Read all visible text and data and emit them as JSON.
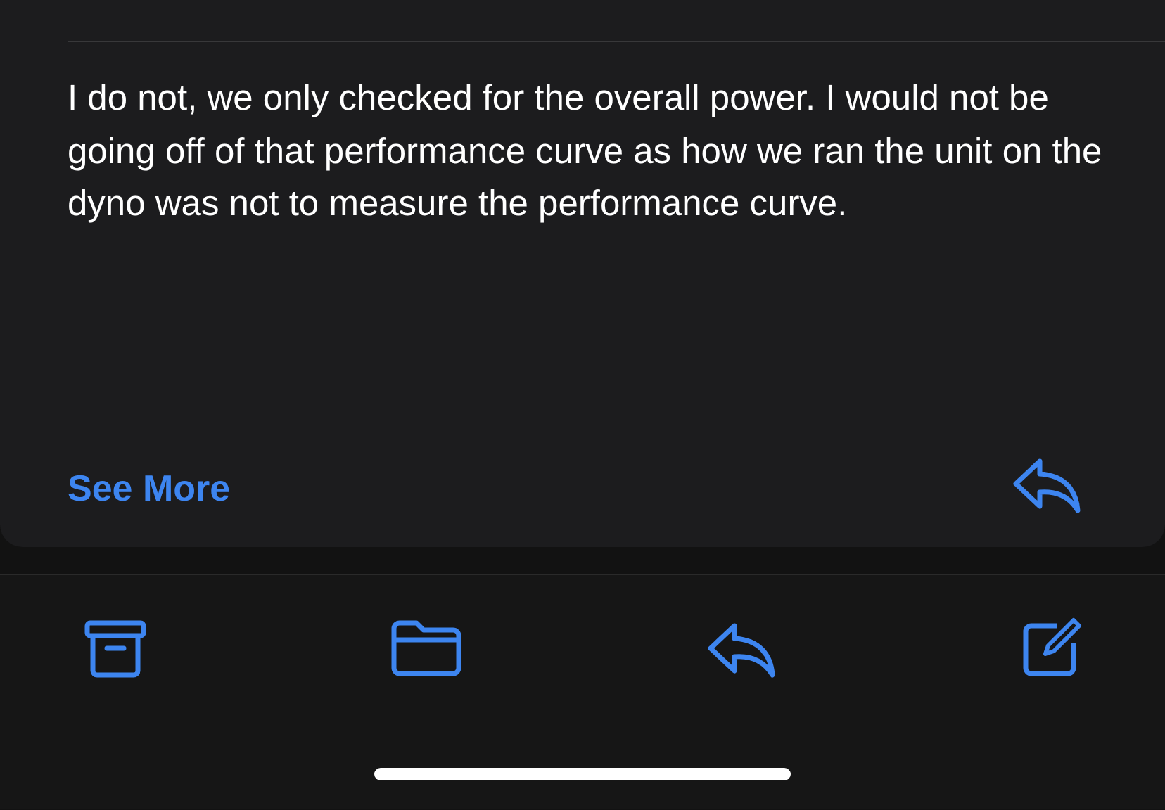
{
  "message": {
    "body": "I do not, we only checked for the overall power. I would not be going off of that performance curve as how we ran the unit on the dyno was not to measure the performance curve."
  },
  "see_more": "See More"
}
